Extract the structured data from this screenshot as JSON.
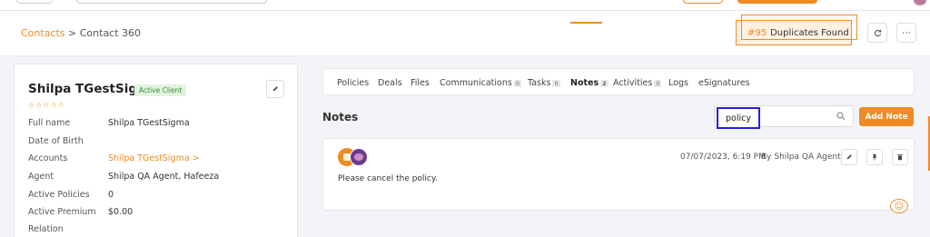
{
  "breadcrumb": {
    "link": "Contacts",
    "separator": ">",
    "current": "Contact 360"
  },
  "duplicates": {
    "number": "#95",
    "label": "Duplicates Found"
  },
  "contact": {
    "name": "Shilpa TGestSigma",
    "status_badge": "Active Client",
    "stars": "☆☆☆☆☆",
    "fields": [
      {
        "label": "Full name",
        "value": "Shilpa TGestSigma"
      },
      {
        "label": "Date of Birth",
        "value": ""
      },
      {
        "label": "Accounts",
        "value": "Shilpa TGestSigma >"
      },
      {
        "label": "Agent",
        "value": "Shilpa QA Agent, Hafeeza"
      },
      {
        "label": "Active Policies",
        "value": "0"
      },
      {
        "label": "Active Premium",
        "value": "$0.00"
      },
      {
        "label": "Relation",
        "value": ""
      }
    ]
  },
  "tabs": [
    {
      "label": "Policies",
      "count": ""
    },
    {
      "label": "Deals",
      "count": ""
    },
    {
      "label": "Files",
      "count": ""
    },
    {
      "label": "Communications",
      "count": "0"
    },
    {
      "label": "Tasks",
      "count": "0"
    },
    {
      "label": "Notes",
      "count": "2"
    },
    {
      "label": "Activities",
      "count": "0"
    },
    {
      "label": "Logs",
      "count": ""
    },
    {
      "label": "eSignatures",
      "count": ""
    }
  ],
  "active_tab": "Notes",
  "notes": {
    "title": "Notes",
    "search_value": "policy",
    "add_button": "Add Note",
    "items": [
      {
        "date": "07/07/2023, 6:19 PM",
        "author": "By Shilpa QA Agent",
        "text": "Please cancel the policy."
      }
    ]
  },
  "colors": {
    "accent": "#f08a24",
    "highlight": "#2a1ee0",
    "badge_bg": "#e3f3df",
    "badge_text": "#3b8c3b"
  },
  "icons": {
    "edit": "pencil-icon",
    "refresh": "refresh-icon",
    "more": "more-icon",
    "search": "search-icon",
    "pin": "pin-icon",
    "delete": "trash-icon",
    "emoji": "smiley-icon"
  }
}
